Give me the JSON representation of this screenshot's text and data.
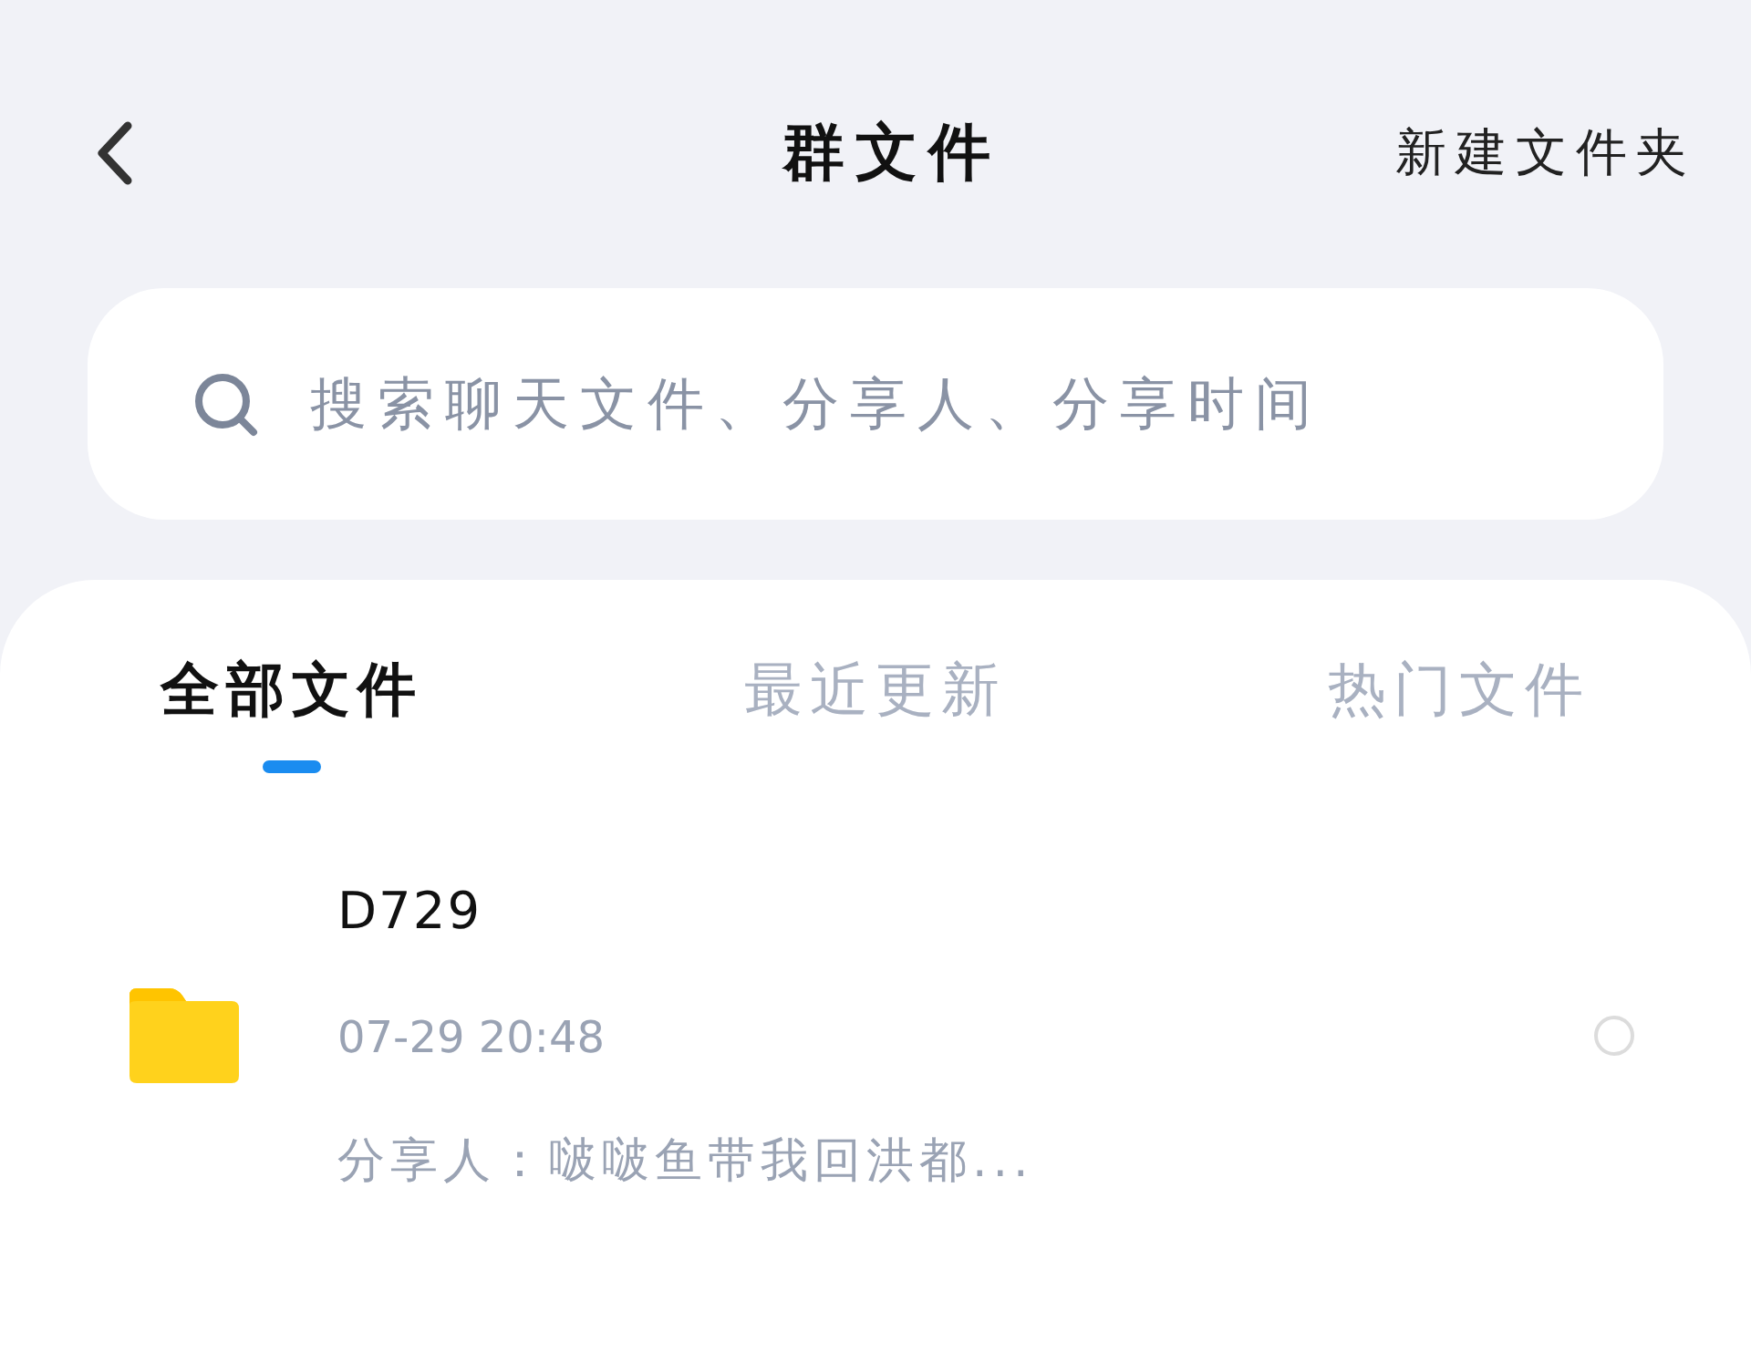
{
  "header": {
    "title": "群文件",
    "action": "新建文件夹"
  },
  "search": {
    "placeholder": "搜索聊天文件、分享人、分享时间"
  },
  "tabs": [
    {
      "label": "全部文件",
      "selected": true
    },
    {
      "label": "最近更新",
      "selected": false
    },
    {
      "label": "热门文件",
      "selected": false
    }
  ],
  "files": [
    {
      "kind": "folder",
      "name": "D729",
      "time": "07-29 20:48",
      "sharer": "分享人：啵啵鱼带我回洪都...",
      "selected": false
    }
  ]
}
